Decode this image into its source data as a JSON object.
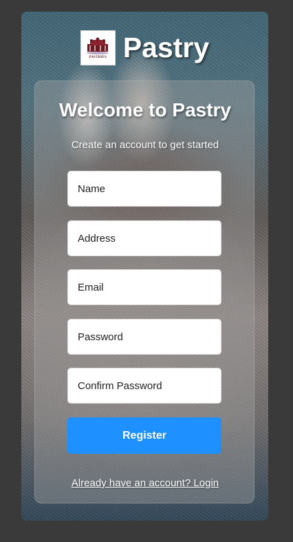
{
  "brand": {
    "logo_text": "PASTRIES",
    "name": "Pastry"
  },
  "form": {
    "heading": "Welcome to Pastry",
    "subheading": "Create an account to get started",
    "fields": {
      "name": {
        "placeholder": "Name",
        "value": ""
      },
      "address": {
        "placeholder": "Address",
        "value": ""
      },
      "email": {
        "placeholder": "Email",
        "value": ""
      },
      "password": {
        "placeholder": "Password",
        "value": ""
      },
      "confirm_password": {
        "placeholder": "Confirm Password",
        "value": ""
      }
    },
    "submit_label": "Register",
    "login_link": "Already have an account? Login"
  },
  "colors": {
    "accent": "#1e90ff",
    "page_background": "#3a3a3a",
    "logo_accent": "#6b1a22"
  }
}
